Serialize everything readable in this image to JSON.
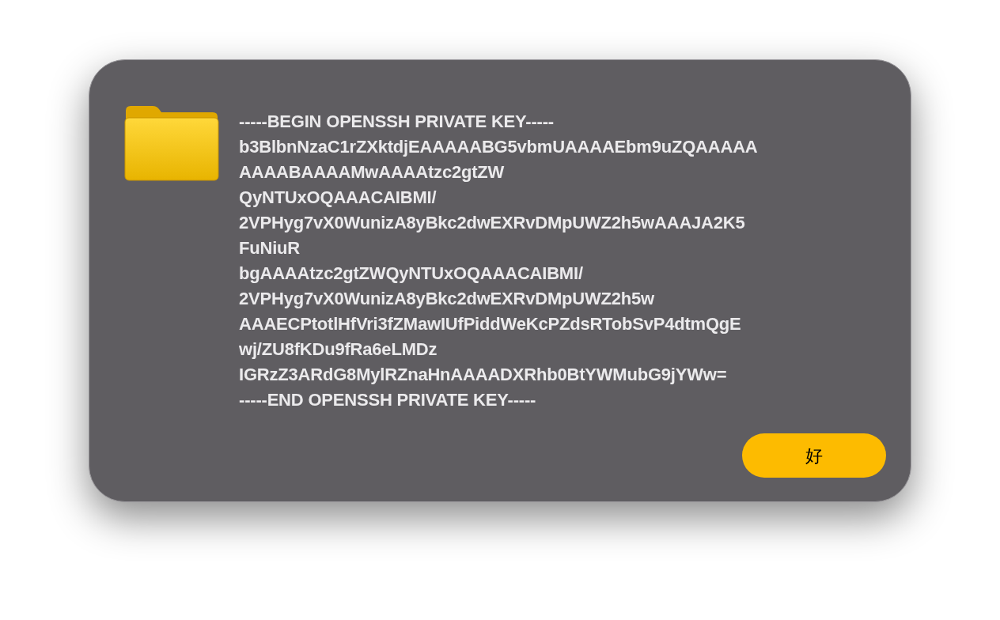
{
  "dialog": {
    "message_lines": [
      "-----BEGIN OPENSSH PRIVATE KEY-----",
      "b3BlbnNzaC1rZXktdjEAAAAABG5vbmUAAAAEbm9uZQAAAAA",
      "AAAABAAAAMwAAAAtzc2gtZW",
      "QyNTUxOQAAACAIBMI/",
      "2VPHyg7vX0WunizA8yBkc2dwEXRvDMpUWZ2h5wAAAJA2K5",
      "FuNiuR",
      "bgAAAAtzc2gtZWQyNTUxOQAAACAIBMI/",
      "2VPHyg7vX0WunizA8yBkc2dwEXRvDMpUWZ2h5w",
      "AAAECPtotlHfVri3fZMawIUfPiddWeKcPZdsRTobSvP4dtmQgE",
      "wj/ZU8fKDu9fRa6eLMDz",
      "IGRzZ3ARdG8MylRZnaHnAAAADXRhb0BtYWMubG9jYWw=",
      "-----END OPENSSH PRIVATE KEY-----"
    ],
    "buttons": [
      {
        "label": "好",
        "kind": "default"
      }
    ]
  }
}
